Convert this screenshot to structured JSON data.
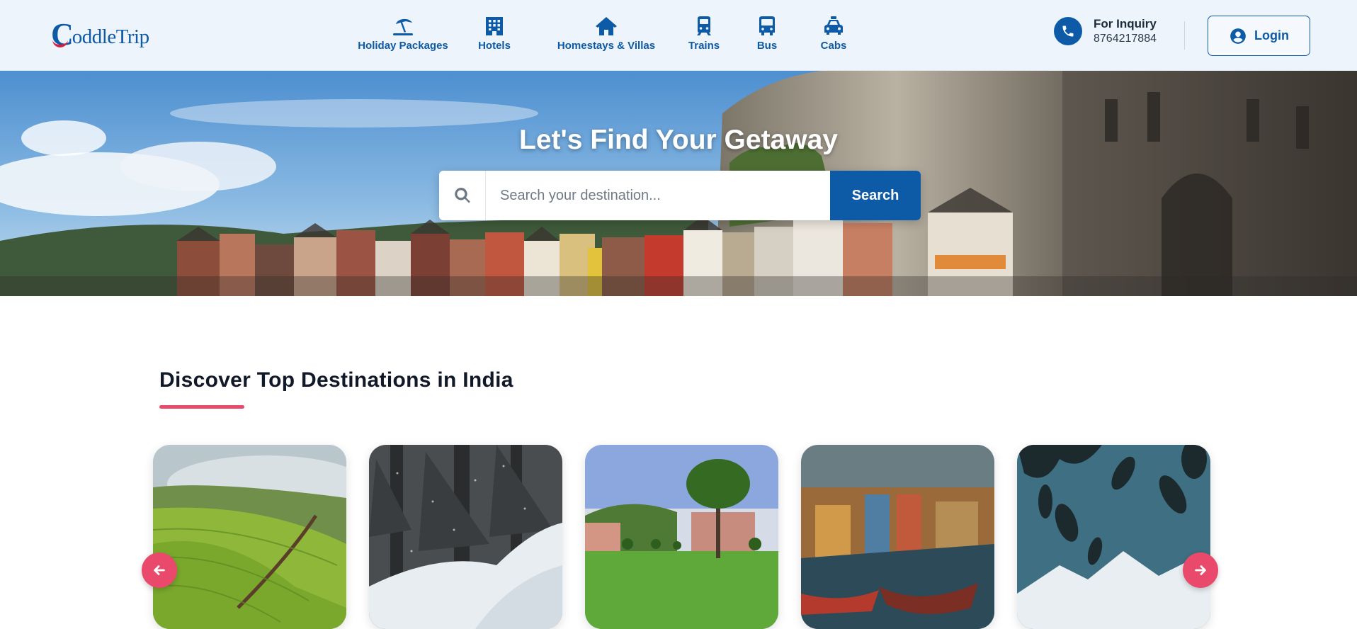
{
  "brand": {
    "logo_initial": "C",
    "logo_rest": "oddleTrip"
  },
  "nav": [
    {
      "label": "Holiday Packages",
      "icon": "beach-umbrella-icon"
    },
    {
      "label": "Hotels",
      "icon": "hotel-building-icon"
    },
    {
      "label": "Homestays & Villas",
      "icon": "house-icon"
    },
    {
      "label": "Trains",
      "icon": "train-icon"
    },
    {
      "label": "Bus",
      "icon": "bus-icon"
    },
    {
      "label": "Cabs",
      "icon": "taxi-icon"
    }
  ],
  "inquiry": {
    "title": "For Inquiry",
    "phone": "8764217884"
  },
  "login": {
    "label": "Login"
  },
  "hero": {
    "title": "Let's Find Your Getaway",
    "search_placeholder": "Search your destination...",
    "search_button": "Search"
  },
  "section": {
    "title": "Discover Top Destinations in India"
  },
  "colors": {
    "primary": "#0d5aa7",
    "accent": "#e94a6c",
    "header_bg": "#eef4fb"
  }
}
